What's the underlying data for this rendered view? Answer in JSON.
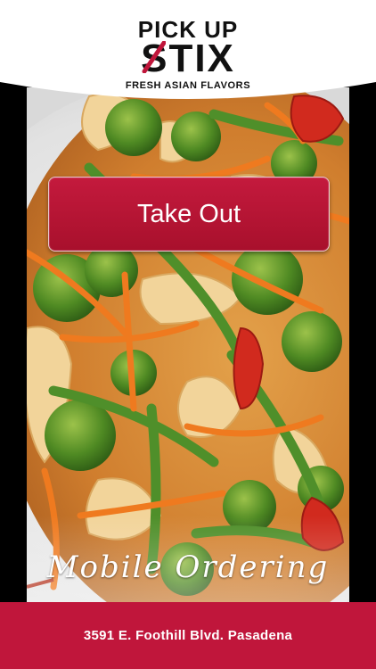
{
  "brand": {
    "name_line1": "PICK UP",
    "name_line2": "STIX",
    "tagline": "FRESH ASIAN FLAVORS",
    "accent_color": "#c0163b"
  },
  "main": {
    "primary_action_label": "Take Out",
    "banner_text": "Mobile Ordering"
  },
  "footer": {
    "address": "3591 E. Foothill Blvd. Pasadena"
  }
}
